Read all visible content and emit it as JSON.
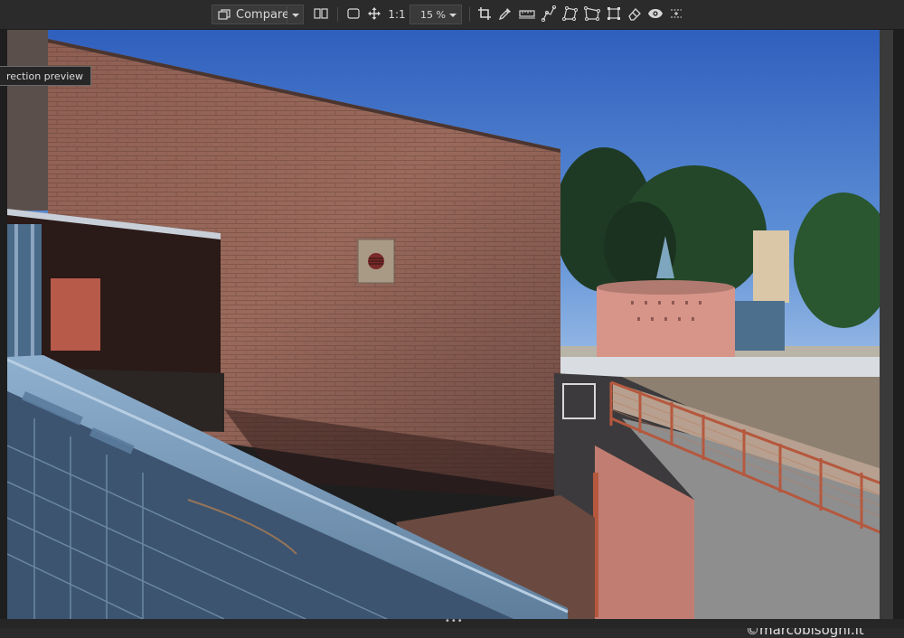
{
  "toolbar": {
    "compare_label": "Compare",
    "actual_size_label": "1:1",
    "zoom_value": "15 %"
  },
  "tooltip": {
    "text": "rection preview"
  },
  "watermark": {
    "text": "©marcobisogni.it"
  },
  "bottom": {
    "handle": "•••"
  },
  "colors": {
    "toolbar_bg": "#2b2b2b",
    "panel_bg": "#1e1e1e",
    "icon": "#d8d8d8"
  },
  "icons": [
    "compare-icon",
    "split-view-icon",
    "fit-icon",
    "pan-icon",
    "crop-icon",
    "eyedropper-icon",
    "straighten-icon",
    "curves-icon",
    "polygon-icon",
    "perspective-icon",
    "transform-icon",
    "eraser-icon",
    "eye-icon",
    "overlay-icon"
  ]
}
